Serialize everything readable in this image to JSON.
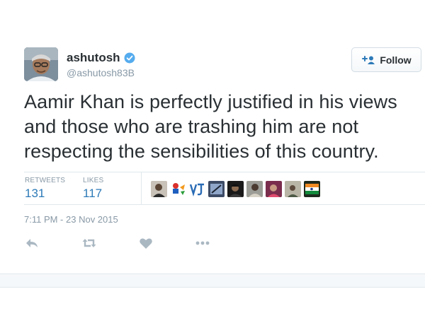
{
  "user": {
    "name": "ashutosh",
    "handle": "@ashutosh83B",
    "verified": true
  },
  "follow_button": {
    "label": "Follow"
  },
  "tweet": {
    "lines": [
      "Aamir Khan is perfectly justified in his views",
      "and those who are trashing him are not",
      "respecting the sensibilities of this country."
    ]
  },
  "stats": {
    "retweets_label": "RETWEETS",
    "retweets_value": "131",
    "likes_label": "LIKES",
    "likes_value": "117"
  },
  "timestamp": "7:11 PM - 23 Nov 2015",
  "actions": [
    "reply-icon",
    "retweet-icon",
    "like-icon",
    "more-icon"
  ],
  "colors": {
    "accent": "#2d7ab8",
    "muted": "#8899a6",
    "text": "#292f33",
    "verified": "#55acee"
  }
}
